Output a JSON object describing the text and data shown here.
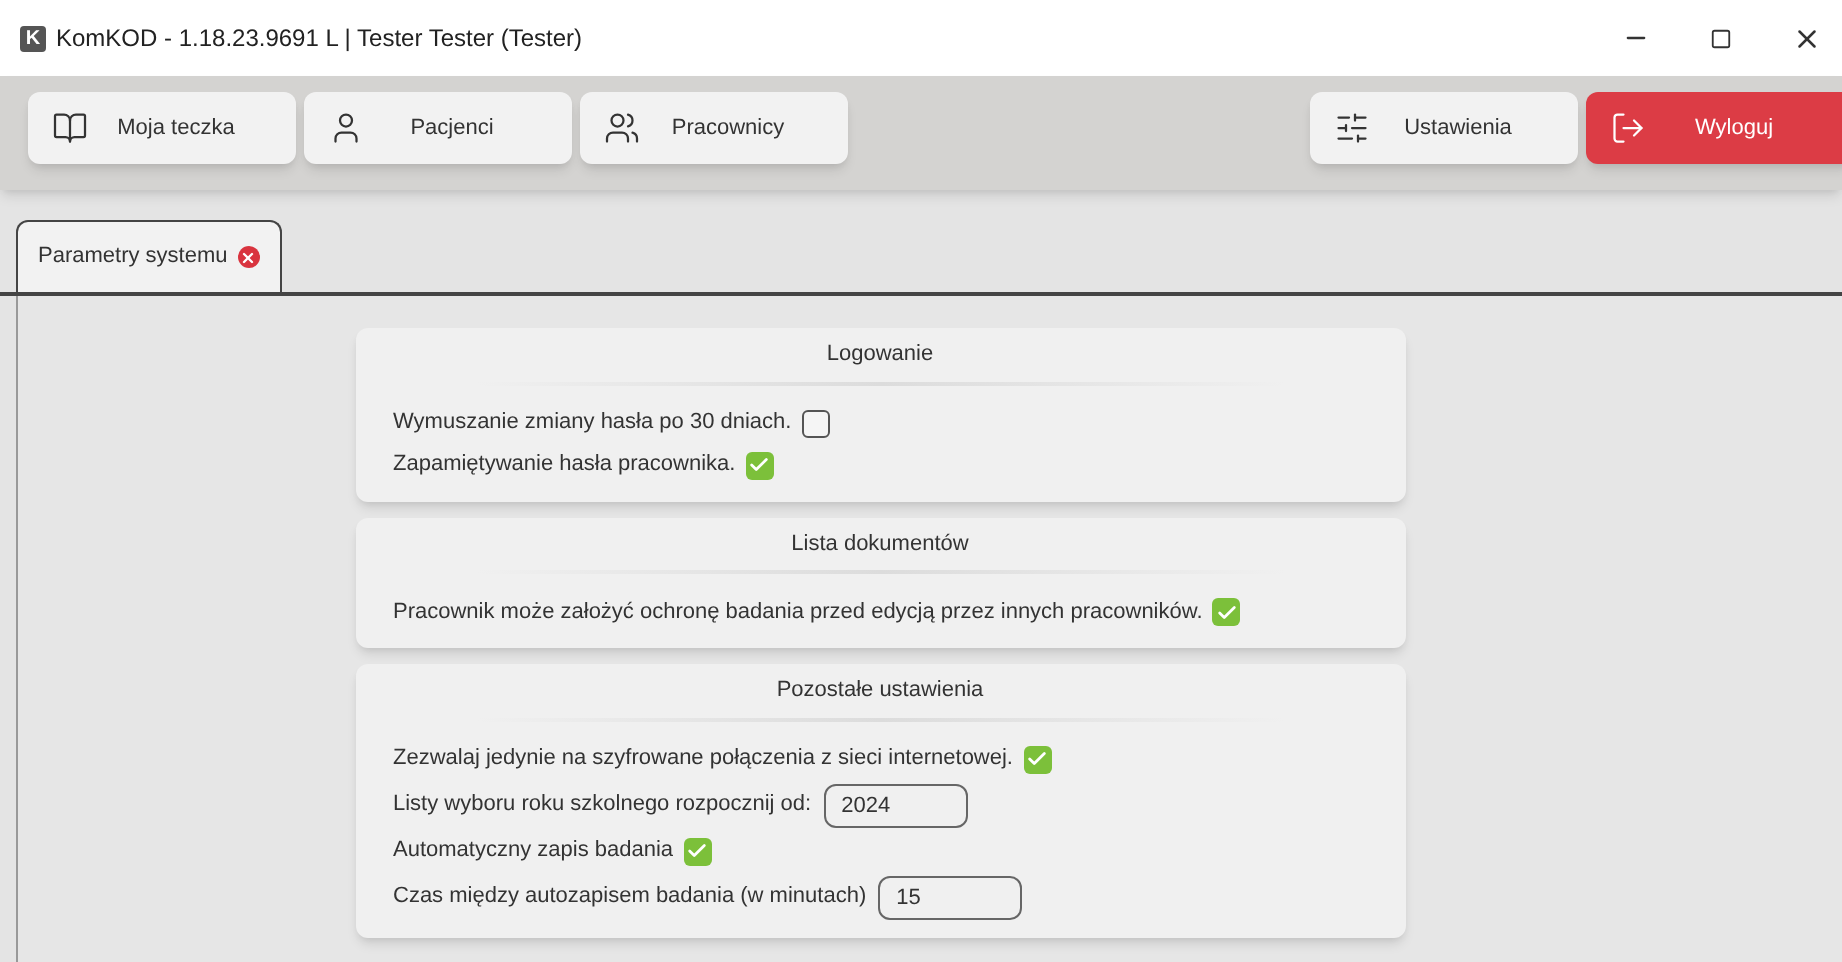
{
  "window": {
    "icon_letter": "K",
    "title": "KomKOD - 1.18.23.9691 L | Tester Tester (Tester)"
  },
  "toolbar": {
    "left": [
      {
        "label": "Moja teczka"
      },
      {
        "label": "Pacjenci"
      },
      {
        "label": "Pracownicy"
      }
    ],
    "right": [
      {
        "label": "Ustawienia",
        "kind": "normal"
      },
      {
        "label": "Wyloguj",
        "kind": "danger"
      }
    ]
  },
  "tabs": [
    {
      "label": "Parametry systemu",
      "selected": true
    }
  ],
  "sections": [
    {
      "title": "Logowanie",
      "items": [
        {
          "kind": "checkbox",
          "label": "Wymuszanie zmiany hasła po 30 dniach.",
          "checked": false
        },
        {
          "kind": "checkbox",
          "label": "Zapamiętywanie hasła pracownika.",
          "checked": true
        }
      ]
    },
    {
      "title": "Lista dokumentów",
      "items": [
        {
          "kind": "checkbox",
          "label": "Pracownik może założyć ochronę badania przed edycją przez innych pracowników.",
          "checked": true
        }
      ]
    },
    {
      "title": "Pozostałe ustawienia",
      "items": [
        {
          "kind": "checkbox",
          "label": "Zezwalaj jedynie na szyfrowane połączenia z sieci internetowej.",
          "checked": true
        },
        {
          "kind": "input",
          "label": "Listy wyboru roku szkolnego rozpocznij od:",
          "value": "2024"
        },
        {
          "kind": "checkbox",
          "label": "Automatyczny zapis badania",
          "checked": true
        },
        {
          "kind": "input",
          "label": "Czas między autozapisem badania (w minutach)",
          "value": "15"
        }
      ]
    }
  ]
}
